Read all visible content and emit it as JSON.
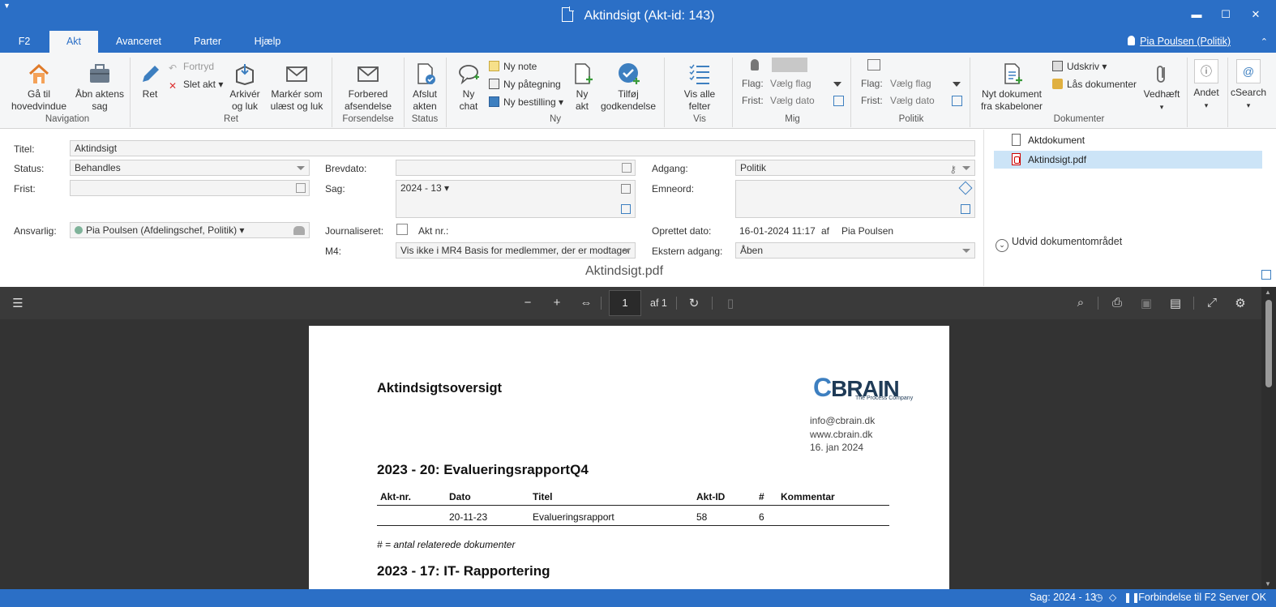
{
  "window": {
    "title": "Aktindsigt (Akt-id: 143)",
    "controls": {
      "minimize": "▬",
      "maximize": "☐",
      "close": "✕"
    }
  },
  "tabs": [
    "F2",
    "Akt",
    "Avanceret",
    "Parter",
    "Hjælp"
  ],
  "active_tab": "Akt",
  "user": "Pia Poulsen (Politik)",
  "ribbon": {
    "navigation": {
      "go_home": "Gå til\nhovedvindue",
      "open_case": "Åbn aktens\nsag",
      "label": "Navigation"
    },
    "ret": {
      "edit": "Ret",
      "undo": "Fortryd",
      "delete": "Slet akt",
      "archive": "Arkivér\nog luk",
      "mark_unread": "Markér som\nulæst og luk",
      "label": "Ret"
    },
    "forsendelse": {
      "prepare": "Forbered\nafsendelse",
      "label": "Forsendelse"
    },
    "status": {
      "complete": "Afslut\nakten",
      "label": "Status"
    },
    "ny": {
      "new_chat": "Ny\nchat",
      "new_note": "Ny note",
      "new_annotation": "Ny påtegning",
      "new_order": "Ny bestilling",
      "new_record": "Ny\nakt",
      "add_approval": "Tilføj\ngodkendelse",
      "label": "Ny"
    },
    "vis": {
      "show_all": "Vis alle\nfelter",
      "label": "Vis"
    },
    "mig": {
      "flag_label": "Flag:",
      "flag_value": "Vælg flag",
      "deadline_label": "Frist:",
      "deadline_value": "Vælg dato",
      "label": "Mig"
    },
    "politik": {
      "flag_label": "Flag:",
      "flag_value": "Vælg flag",
      "deadline_label": "Frist:",
      "deadline_value": "Vælg dato",
      "label": "Politik"
    },
    "dokumenter": {
      "new_doc": "Nyt dokument\nfra skabeloner",
      "print": "Udskriv",
      "lock": "Lås dokumenter",
      "attach": "Vedhæft",
      "label": "Dokumenter"
    },
    "other": {
      "andet": "Andet",
      "csearch": "cSearch"
    }
  },
  "form": {
    "titel": {
      "label": "Titel:",
      "value": "Aktindsigt"
    },
    "status": {
      "label": "Status:",
      "value": "Behandles"
    },
    "frist": {
      "label": "Frist:",
      "value": ""
    },
    "ansvarlig": {
      "label": "Ansvarlig:",
      "value": "Pia Poulsen (Afdelingschef, Politik)"
    },
    "brevdato": {
      "label": "Brevdato:",
      "value": ""
    },
    "sag": {
      "label": "Sag:",
      "value": "2024 - 13"
    },
    "journaliseret": {
      "label": "Journaliseret:",
      "checked": false,
      "akt_nr_label": "Akt nr.:"
    },
    "m4": {
      "label": "M4:",
      "value": "Vis ikke i MR4 Basis for medlemmer, der er modtager"
    },
    "adgang": {
      "label": "Adgang:",
      "value": "Politik"
    },
    "emneord": {
      "label": "Emneord:",
      "value": ""
    },
    "oprettet": {
      "label": "Oprettet dato:",
      "value": "16-01-2024 11:17",
      "af_label": "af",
      "by": "Pia Poulsen"
    },
    "ekstern_adgang": {
      "label": "Ekstern adgang:",
      "value": "Åben"
    }
  },
  "documents": {
    "items": [
      {
        "name": "Aktdokument",
        "type": "doc",
        "selected": false
      },
      {
        "name": "Aktindsigt.pdf",
        "type": "pdf",
        "selected": true
      }
    ],
    "expand_label": "Udvid dokumentområdet"
  },
  "viewer": {
    "filename": "Aktindsigt.pdf",
    "page": "1",
    "page_of": "af 1"
  },
  "pdf": {
    "title": "Aktindsigtsoversigt",
    "logo": {
      "text": "CBRAIN",
      "tagline": "The Process Company"
    },
    "contact": [
      "info@cbrain.dk",
      "www.cbrain.dk",
      "16. jan 2024"
    ],
    "section1": "2023 - 20: EvalueringsrapportQ4",
    "table_headers": [
      "Akt-nr.",
      "Dato",
      "Titel",
      "Akt-ID",
      "#",
      "Kommentar"
    ],
    "table_rows": [
      [
        "",
        "20-11-23",
        "Evalueringsrapport",
        "58",
        "6",
        ""
      ]
    ],
    "note": "# = antal relaterede dokumenter",
    "section2": "2023 - 17: IT- Rapportering"
  },
  "statusbar": {
    "sag": "Sag: 2024 - 13",
    "connection": "Forbindelse til F2 Server OK"
  },
  "colors": {
    "accent": "#2b6fc6",
    "viewer_bg": "#333333",
    "selection": "#cce4f7"
  }
}
